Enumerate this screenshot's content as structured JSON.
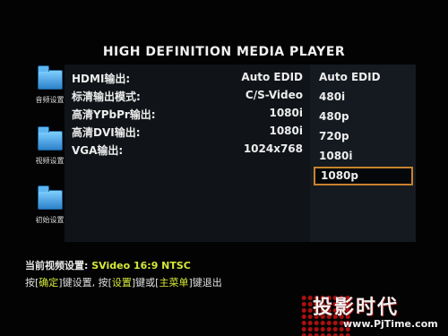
{
  "header": {
    "title": "HIGH DEFINITION MEDIA PLAYER"
  },
  "sidebar": {
    "items": [
      {
        "label": "音频设置",
        "icon": "folder-icon"
      },
      {
        "label": "视频设置",
        "icon": "folder-icon"
      },
      {
        "label": "初始设置",
        "icon": "folder-icon"
      }
    ]
  },
  "settings": [
    {
      "label": "HDMI输出:",
      "value": "Auto EDID"
    },
    {
      "label": "标清输出模式:",
      "value": "C/S-Video"
    },
    {
      "label": "高清YPbPr输出:",
      "value": "1080i"
    },
    {
      "label": "高清DVI输出:",
      "value": "1080i"
    },
    {
      "label": "VGA输出:",
      "value": "1024x768"
    }
  ],
  "options": {
    "items": [
      "Auto EDID",
      "480i",
      "480p",
      "720p",
      "1080i",
      "1080p"
    ],
    "selected": "1080p"
  },
  "status": {
    "prefix": "当前视频设置:",
    "value": "SVideo  16:9  NTSC"
  },
  "help": {
    "part1": "按[",
    "key1": "确定",
    "part2": "]键设置, 按[",
    "key2": "设置",
    "part3": "]键或[",
    "key3": "主菜单",
    "part4": "]键退出"
  },
  "watermark": {
    "name": "投影时代",
    "url": "www.PjTime.com",
    "accent": "#d21414"
  },
  "colors": {
    "background": "#030303",
    "highlight": "#d6e83a",
    "selection_border": "#c8822c"
  }
}
